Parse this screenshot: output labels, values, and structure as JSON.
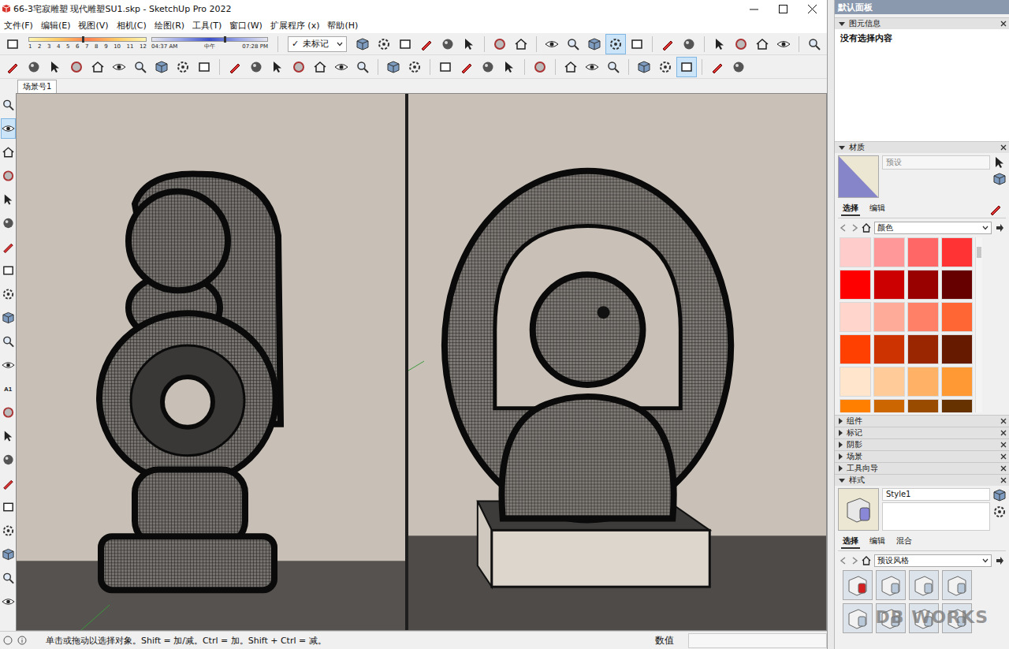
{
  "window": {
    "title": "66-3宅寂雕塑 现代雕塑SU1.skp - SketchUp Pro 2022"
  },
  "menu": [
    "文件(F)",
    "编辑(E)",
    "视图(V)",
    "相机(C)",
    "绘图(R)",
    "工具(T)",
    "窗口(W)",
    "扩展程序 (x)",
    "帮助(H)"
  ],
  "shadow": {
    "months": [
      "1",
      "2",
      "3",
      "4",
      "5",
      "6",
      "7",
      "8",
      "9",
      "10",
      "11",
      "12"
    ],
    "month_level": 0.45,
    "times": [
      "04:37 AM",
      "中午",
      "07:28 PM"
    ],
    "time_level": 0.62
  },
  "tag_select": {
    "check": "✓",
    "value": "未标记"
  },
  "toolbar1": [
    {
      "selected": false
    },
    {
      "selected": false
    },
    {
      "selected": false
    },
    {
      "selected": false
    },
    {
      "selected": false
    },
    {
      "selected": false
    },
    {
      "selected": false
    },
    {
      "selected": false
    },
    {
      "selected": false
    },
    {
      "selected": false
    },
    {
      "selected": false
    },
    {
      "selected": true
    },
    {
      "selected": false
    },
    {
      "selected": false
    },
    {
      "selected": false
    },
    {
      "selected": false
    },
    {
      "selected": false
    },
    {
      "selected": false
    },
    {
      "selected": false
    },
    {
      "selected": false
    }
  ],
  "toolbar2": [
    {
      "selected": false
    },
    {
      "selected": false
    },
    {
      "selected": false
    },
    {
      "selected": false
    },
    {
      "selected": false
    },
    {
      "selected": false
    },
    {
      "selected": false
    },
    {
      "selected": false
    },
    {
      "selected": false
    },
    {
      "selected": false
    },
    {
      "selected": false
    },
    {
      "selected": false
    },
    {
      "selected": false
    },
    {
      "selected": false
    },
    {
      "selected": false
    },
    {
      "selected": false
    },
    {
      "selected": false
    },
    {
      "selected": false
    },
    {
      "selected": false
    },
    {
      "selected": false
    },
    {
      "selected": false
    },
    {
      "selected": false
    },
    {
      "selected": false
    },
    {
      "selected": false
    },
    {
      "selected": false
    },
    {
      "selected": false
    },
    {
      "selected": false
    },
    {
      "selected": false
    },
    {
      "selected": false
    },
    {
      "selected": true
    },
    {
      "selected": false
    },
    {
      "selected": false
    }
  ],
  "left_toolbar": [
    {
      "label": "",
      "selected": false
    },
    {
      "label": "",
      "selected": true
    },
    {
      "label": "",
      "selected": false
    },
    {
      "label": "",
      "selected": false
    },
    {
      "label": "",
      "selected": false
    },
    {
      "label": "",
      "selected": false
    },
    {
      "label": "",
      "selected": false
    },
    {
      "label": "",
      "selected": false
    },
    {
      "label": "",
      "selected": false
    },
    {
      "label": "",
      "selected": false
    },
    {
      "label": "",
      "selected": false
    },
    {
      "label": "",
      "selected": false
    },
    {
      "label": "A1",
      "selected": false
    },
    {
      "label": "",
      "selected": false
    },
    {
      "label": "",
      "selected": false
    },
    {
      "label": "",
      "selected": false
    },
    {
      "label": "",
      "selected": false
    },
    {
      "label": "",
      "selected": false
    },
    {
      "label": "",
      "selected": false
    },
    {
      "label": "",
      "selected": false
    },
    {
      "label": "",
      "selected": false
    },
    {
      "label": "",
      "selected": false
    }
  ],
  "scene_tabs": [
    {
      "label": "场景号1",
      "selected": true
    }
  ],
  "status_bar": {
    "hint": "单击或拖动以选择对象。Shift = 加/减。Ctrl = 加。Shift + Ctrl = 减。",
    "measure_label": "数值",
    "measure_value": ""
  },
  "tray": {
    "title": "默认面板",
    "entity_info": {
      "title": "图元信息",
      "expanded": true,
      "text": "没有选择内容"
    },
    "materials": {
      "title": "材质",
      "expanded": true,
      "name_placeholder": "预设",
      "tabs": [
        {
          "label": "选择",
          "selected": true
        },
        {
          "label": "编辑",
          "selected": false
        }
      ],
      "library": "颜色",
      "swatches": [
        {
          "color": "#ffcccc"
        },
        {
          "color": "#ff9999"
        },
        {
          "color": "#ff6666"
        },
        {
          "color": "#ff3333"
        },
        {
          "color": "#ff0000"
        },
        {
          "color": "#cc0000"
        },
        {
          "color": "#990000"
        },
        {
          "color": "#660000"
        },
        {
          "color": "#ffd5cc"
        },
        {
          "color": "#ffab99"
        },
        {
          "color": "#ff8066"
        },
        {
          "color": "#ff6633"
        },
        {
          "color": "#ff4000"
        },
        {
          "color": "#cc3300"
        },
        {
          "color": "#992600"
        },
        {
          "color": "#661a00"
        },
        {
          "color": "#ffe5cc"
        },
        {
          "color": "#ffcc99"
        },
        {
          "color": "#ffb266"
        },
        {
          "color": "#ff9933"
        },
        {
          "color": "#ff8000"
        },
        {
          "color": "#cc6600"
        },
        {
          "color": "#994c00"
        },
        {
          "color": "#663300"
        }
      ]
    },
    "collapsed": [
      {
        "title": "组件",
        "expanded": false
      },
      {
        "title": "标记",
        "expanded": false
      },
      {
        "title": "阴影",
        "expanded": false
      },
      {
        "title": "场景",
        "expanded": false
      },
      {
        "title": "工具向导",
        "expanded": false
      }
    ],
    "styles": {
      "title": "样式",
      "expanded": true,
      "name": "Style1",
      "tabs": [
        {
          "label": "选择",
          "selected": true
        },
        {
          "label": "编辑",
          "selected": false
        },
        {
          "label": "混合",
          "selected": false
        }
      ],
      "library": "预设风格",
      "thumbnails": [
        {
          "selected": false
        },
        {
          "selected": false
        },
        {
          "selected": false
        },
        {
          "selected": false
        },
        {
          "selected": false
        },
        {
          "selected": false
        },
        {
          "selected": false
        },
        {
          "selected": false
        }
      ]
    }
  },
  "watermark": "DB WORKS"
}
